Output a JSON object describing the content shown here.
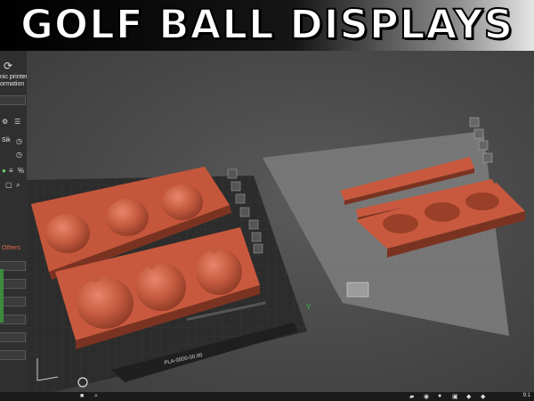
{
  "banner": {
    "title": "GOLF BALL DISPLAYS"
  },
  "left_panel": {
    "printer_label_1": "nic printer",
    "printer_label_2": "ormation",
    "size_label": "Sik",
    "others_label": "Others"
  },
  "scene": {
    "left_plate_label": "PLA-0000-00.00",
    "axis_label": "Y"
  },
  "colors": {
    "model": "#c9593e",
    "bed": "#2c2c2c",
    "bed_grid": "#3a3a3a",
    "panel": "#2f2f2f",
    "accent": "#3c8c3c"
  },
  "icons": [
    "refresh-icon",
    "settings-icon",
    "list-icon",
    "percent-icon",
    "search-icon",
    "close-icon",
    "layers-icon",
    "grid-icon",
    "home-icon",
    "windows-icon",
    "search-taskbar-icon",
    "folder-icon",
    "browser-icon",
    "chat-icon",
    "mail-icon"
  ],
  "taskbar": {
    "time": "9:1"
  }
}
